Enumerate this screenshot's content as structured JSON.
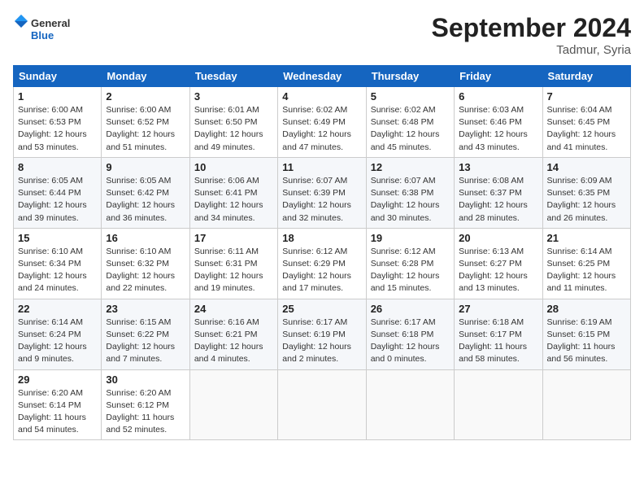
{
  "header": {
    "logo_line1": "General",
    "logo_line2": "Blue",
    "month": "September 2024",
    "location": "Tadmur, Syria"
  },
  "weekdays": [
    "Sunday",
    "Monday",
    "Tuesday",
    "Wednesday",
    "Thursday",
    "Friday",
    "Saturday"
  ],
  "weeks": [
    [
      {
        "day": "1",
        "info": "Sunrise: 6:00 AM\nSunset: 6:53 PM\nDaylight: 12 hours\nand 53 minutes."
      },
      {
        "day": "2",
        "info": "Sunrise: 6:00 AM\nSunset: 6:52 PM\nDaylight: 12 hours\nand 51 minutes."
      },
      {
        "day": "3",
        "info": "Sunrise: 6:01 AM\nSunset: 6:50 PM\nDaylight: 12 hours\nand 49 minutes."
      },
      {
        "day": "4",
        "info": "Sunrise: 6:02 AM\nSunset: 6:49 PM\nDaylight: 12 hours\nand 47 minutes."
      },
      {
        "day": "5",
        "info": "Sunrise: 6:02 AM\nSunset: 6:48 PM\nDaylight: 12 hours\nand 45 minutes."
      },
      {
        "day": "6",
        "info": "Sunrise: 6:03 AM\nSunset: 6:46 PM\nDaylight: 12 hours\nand 43 minutes."
      },
      {
        "day": "7",
        "info": "Sunrise: 6:04 AM\nSunset: 6:45 PM\nDaylight: 12 hours\nand 41 minutes."
      }
    ],
    [
      {
        "day": "8",
        "info": "Sunrise: 6:05 AM\nSunset: 6:44 PM\nDaylight: 12 hours\nand 39 minutes."
      },
      {
        "day": "9",
        "info": "Sunrise: 6:05 AM\nSunset: 6:42 PM\nDaylight: 12 hours\nand 36 minutes."
      },
      {
        "day": "10",
        "info": "Sunrise: 6:06 AM\nSunset: 6:41 PM\nDaylight: 12 hours\nand 34 minutes."
      },
      {
        "day": "11",
        "info": "Sunrise: 6:07 AM\nSunset: 6:39 PM\nDaylight: 12 hours\nand 32 minutes."
      },
      {
        "day": "12",
        "info": "Sunrise: 6:07 AM\nSunset: 6:38 PM\nDaylight: 12 hours\nand 30 minutes."
      },
      {
        "day": "13",
        "info": "Sunrise: 6:08 AM\nSunset: 6:37 PM\nDaylight: 12 hours\nand 28 minutes."
      },
      {
        "day": "14",
        "info": "Sunrise: 6:09 AM\nSunset: 6:35 PM\nDaylight: 12 hours\nand 26 minutes."
      }
    ],
    [
      {
        "day": "15",
        "info": "Sunrise: 6:10 AM\nSunset: 6:34 PM\nDaylight: 12 hours\nand 24 minutes."
      },
      {
        "day": "16",
        "info": "Sunrise: 6:10 AM\nSunset: 6:32 PM\nDaylight: 12 hours\nand 22 minutes."
      },
      {
        "day": "17",
        "info": "Sunrise: 6:11 AM\nSunset: 6:31 PM\nDaylight: 12 hours\nand 19 minutes."
      },
      {
        "day": "18",
        "info": "Sunrise: 6:12 AM\nSunset: 6:29 PM\nDaylight: 12 hours\nand 17 minutes."
      },
      {
        "day": "19",
        "info": "Sunrise: 6:12 AM\nSunset: 6:28 PM\nDaylight: 12 hours\nand 15 minutes."
      },
      {
        "day": "20",
        "info": "Sunrise: 6:13 AM\nSunset: 6:27 PM\nDaylight: 12 hours\nand 13 minutes."
      },
      {
        "day": "21",
        "info": "Sunrise: 6:14 AM\nSunset: 6:25 PM\nDaylight: 12 hours\nand 11 minutes."
      }
    ],
    [
      {
        "day": "22",
        "info": "Sunrise: 6:14 AM\nSunset: 6:24 PM\nDaylight: 12 hours\nand 9 minutes."
      },
      {
        "day": "23",
        "info": "Sunrise: 6:15 AM\nSunset: 6:22 PM\nDaylight: 12 hours\nand 7 minutes."
      },
      {
        "day": "24",
        "info": "Sunrise: 6:16 AM\nSunset: 6:21 PM\nDaylight: 12 hours\nand 4 minutes."
      },
      {
        "day": "25",
        "info": "Sunrise: 6:17 AM\nSunset: 6:19 PM\nDaylight: 12 hours\nand 2 minutes."
      },
      {
        "day": "26",
        "info": "Sunrise: 6:17 AM\nSunset: 6:18 PM\nDaylight: 12 hours\nand 0 minutes."
      },
      {
        "day": "27",
        "info": "Sunrise: 6:18 AM\nSunset: 6:17 PM\nDaylight: 11 hours\nand 58 minutes."
      },
      {
        "day": "28",
        "info": "Sunrise: 6:19 AM\nSunset: 6:15 PM\nDaylight: 11 hours\nand 56 minutes."
      }
    ],
    [
      {
        "day": "29",
        "info": "Sunrise: 6:20 AM\nSunset: 6:14 PM\nDaylight: 11 hours\nand 54 minutes."
      },
      {
        "day": "30",
        "info": "Sunrise: 6:20 AM\nSunset: 6:12 PM\nDaylight: 11 hours\nand 52 minutes."
      },
      null,
      null,
      null,
      null,
      null
    ]
  ]
}
